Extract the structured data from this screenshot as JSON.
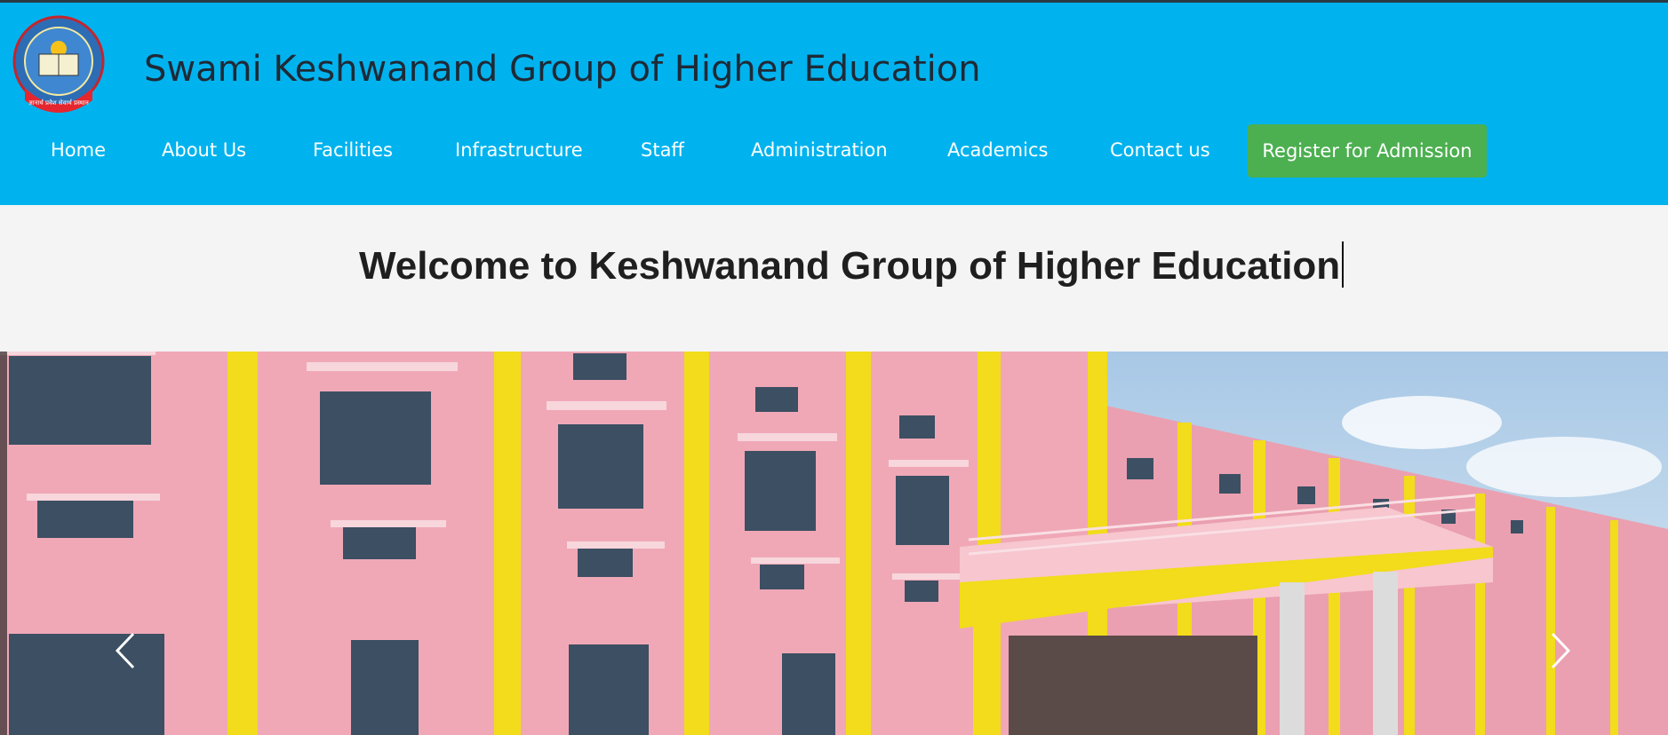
{
  "header": {
    "site_title": "Swami Keshwanand Group of Higher Education",
    "logo": {
      "icon": "college-emblem-icon",
      "ring_text": "केशवानन्द के सा. विद्या समूह",
      "banner_text": "ज्ञानार्थ प्रवेश सेवार्थ प्रस्थान"
    }
  },
  "nav": {
    "items": [
      {
        "label": "Home"
      },
      {
        "label": "About Us"
      },
      {
        "label": "Facilities"
      },
      {
        "label": "Infrastructure"
      },
      {
        "label": "Staff"
      },
      {
        "label": "Administration"
      },
      {
        "label": "Academics"
      },
      {
        "label": "Contact us"
      }
    ],
    "register_label": "Register for Admission"
  },
  "hero": {
    "welcome": "Welcome to Keshwanand Group of Higher Education"
  },
  "carousel": {
    "prev_icon": "chevron-left-icon",
    "next_icon": "chevron-right-icon"
  },
  "colors": {
    "header_bg": "#00b3ee",
    "register_bg": "#4caf50",
    "building_pink": "#f1a9b8",
    "building_yellow": "#f2dc1b"
  }
}
